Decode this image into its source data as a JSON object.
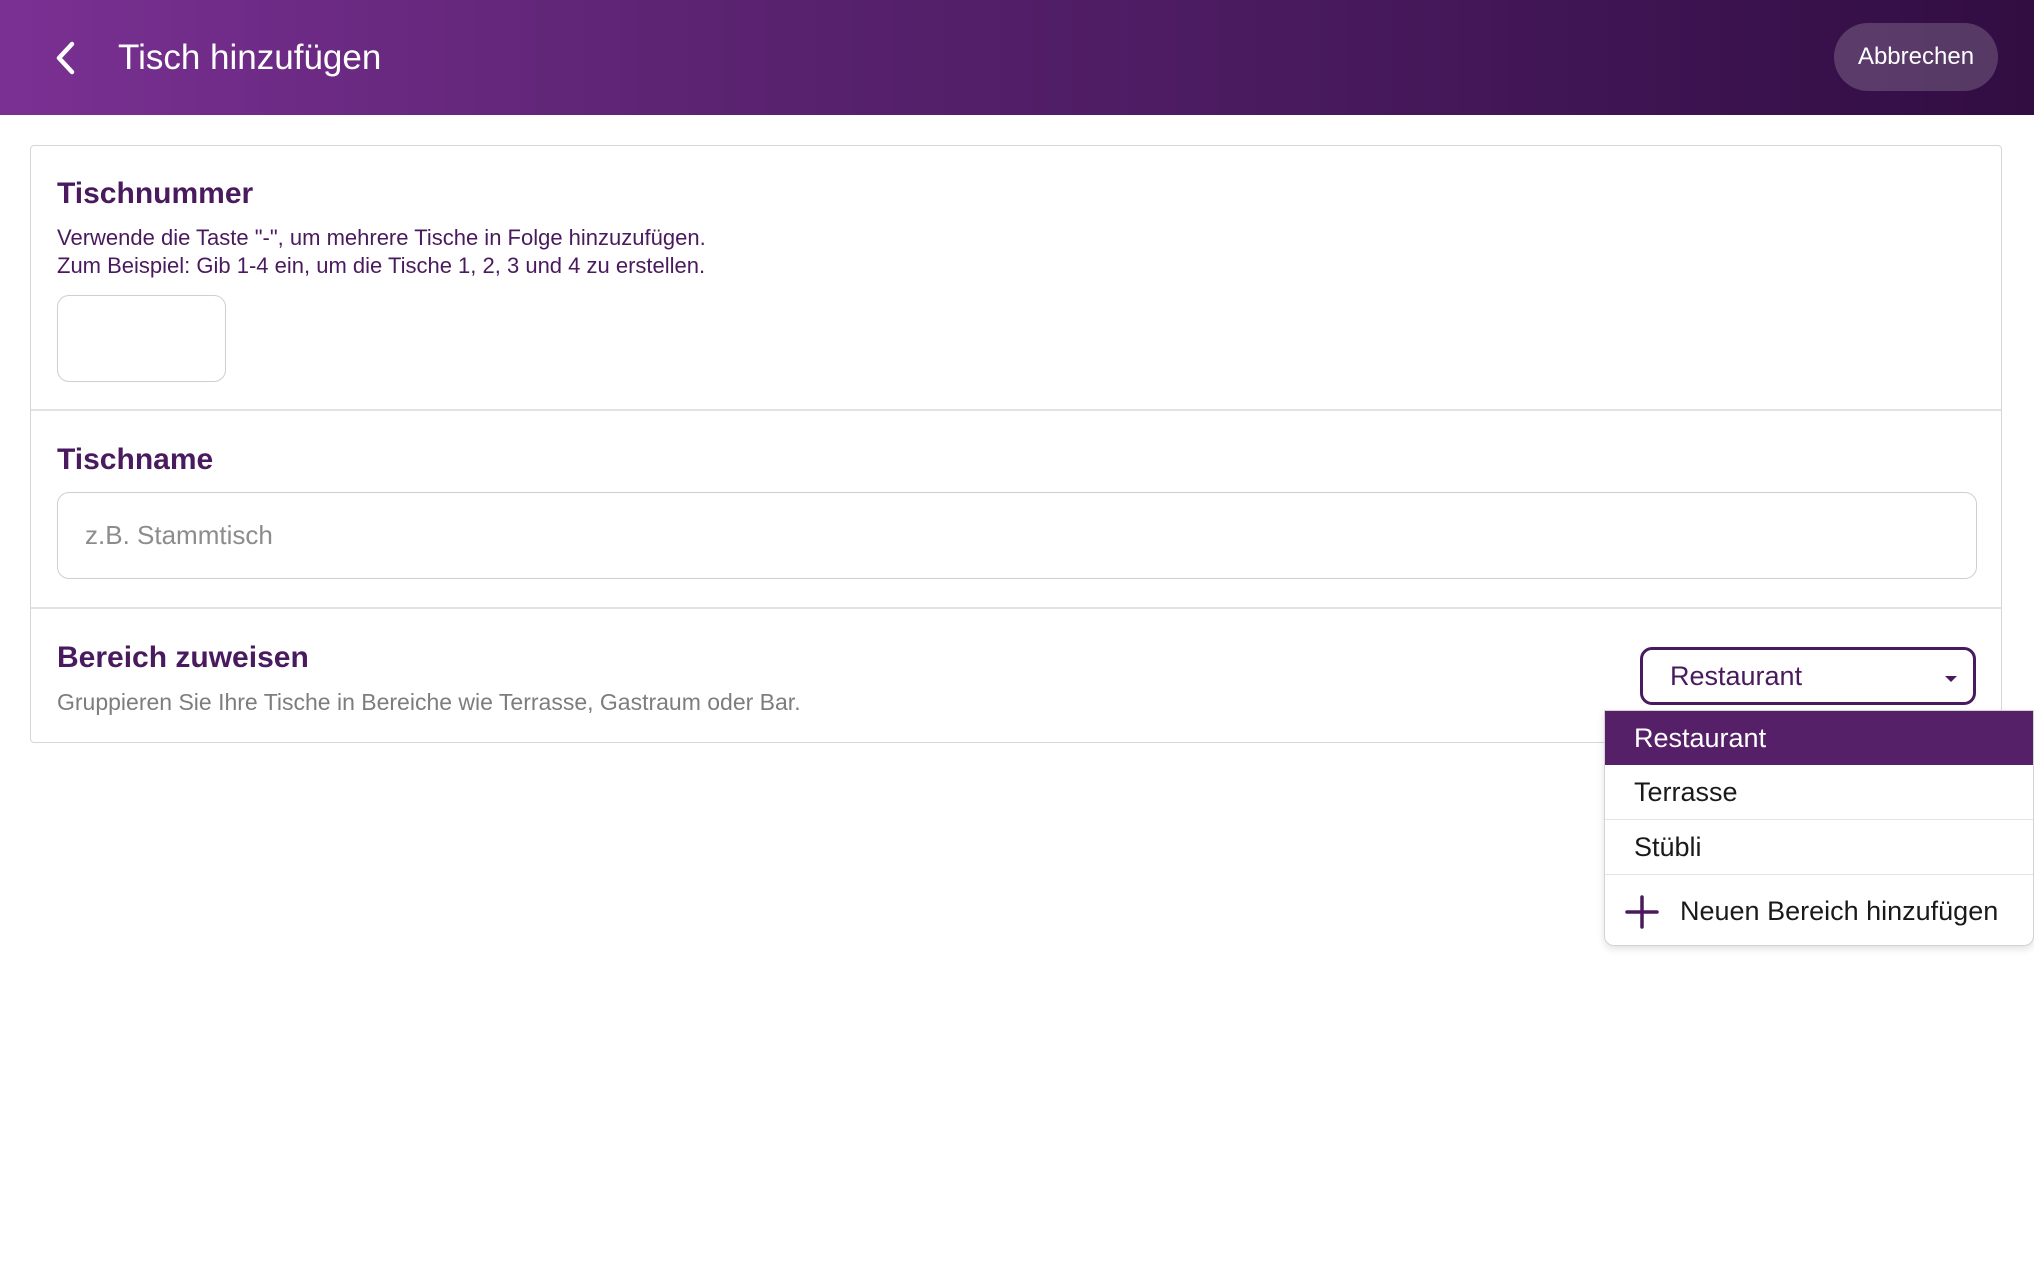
{
  "header": {
    "title": "Tisch hinzufügen",
    "cancel_label": "Abbrechen"
  },
  "table_number": {
    "label": "Tischnummer",
    "help_line1": "Verwende die Taste \"-\", um mehrere Tische in Folge hinzuzufügen.",
    "help_line2": "Zum Beispiel: Gib 1-4 ein, um die Tische 1, 2, 3 und 4 zu erstellen.",
    "value": ""
  },
  "table_name": {
    "label": "Tischname",
    "placeholder": "z.B. Stammtisch",
    "value": ""
  },
  "area": {
    "label": "Bereich zuweisen",
    "help": "Gruppieren Sie Ihre Tische in Bereiche wie Terrasse, Gastraum oder Bar.",
    "selected": "Restaurant",
    "options": [
      "Restaurant",
      "Terrasse",
      "Stübli"
    ],
    "add_label": "Neuen Bereich hinzufügen"
  },
  "colors": {
    "accent": "#562068",
    "header_start": "#7a3093",
    "header_end": "#310d42"
  }
}
